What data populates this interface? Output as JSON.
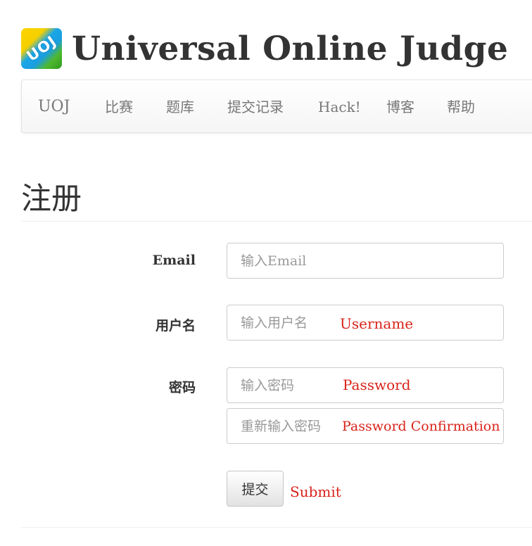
{
  "header": {
    "logo_text": "UOJ",
    "title": "Universal Online Judge"
  },
  "navbar": {
    "brand": "UOJ",
    "items": [
      "比赛",
      "题库",
      "提交记录",
      "Hack!",
      "博客",
      "帮助"
    ]
  },
  "page": {
    "title": "注册"
  },
  "form": {
    "email_label": "Email",
    "email_placeholder": "输入Email",
    "username_label": "用户名",
    "username_placeholder": "输入用户名",
    "password_label": "密码",
    "password_placeholder": "输入密码",
    "confirm_placeholder": "重新输入密码",
    "submit_label": "提交"
  },
  "annotations": {
    "username": "Username",
    "password": "Password",
    "confirm": "Password Confirmation",
    "submit": "Submit",
    "color": "#d9231a"
  }
}
